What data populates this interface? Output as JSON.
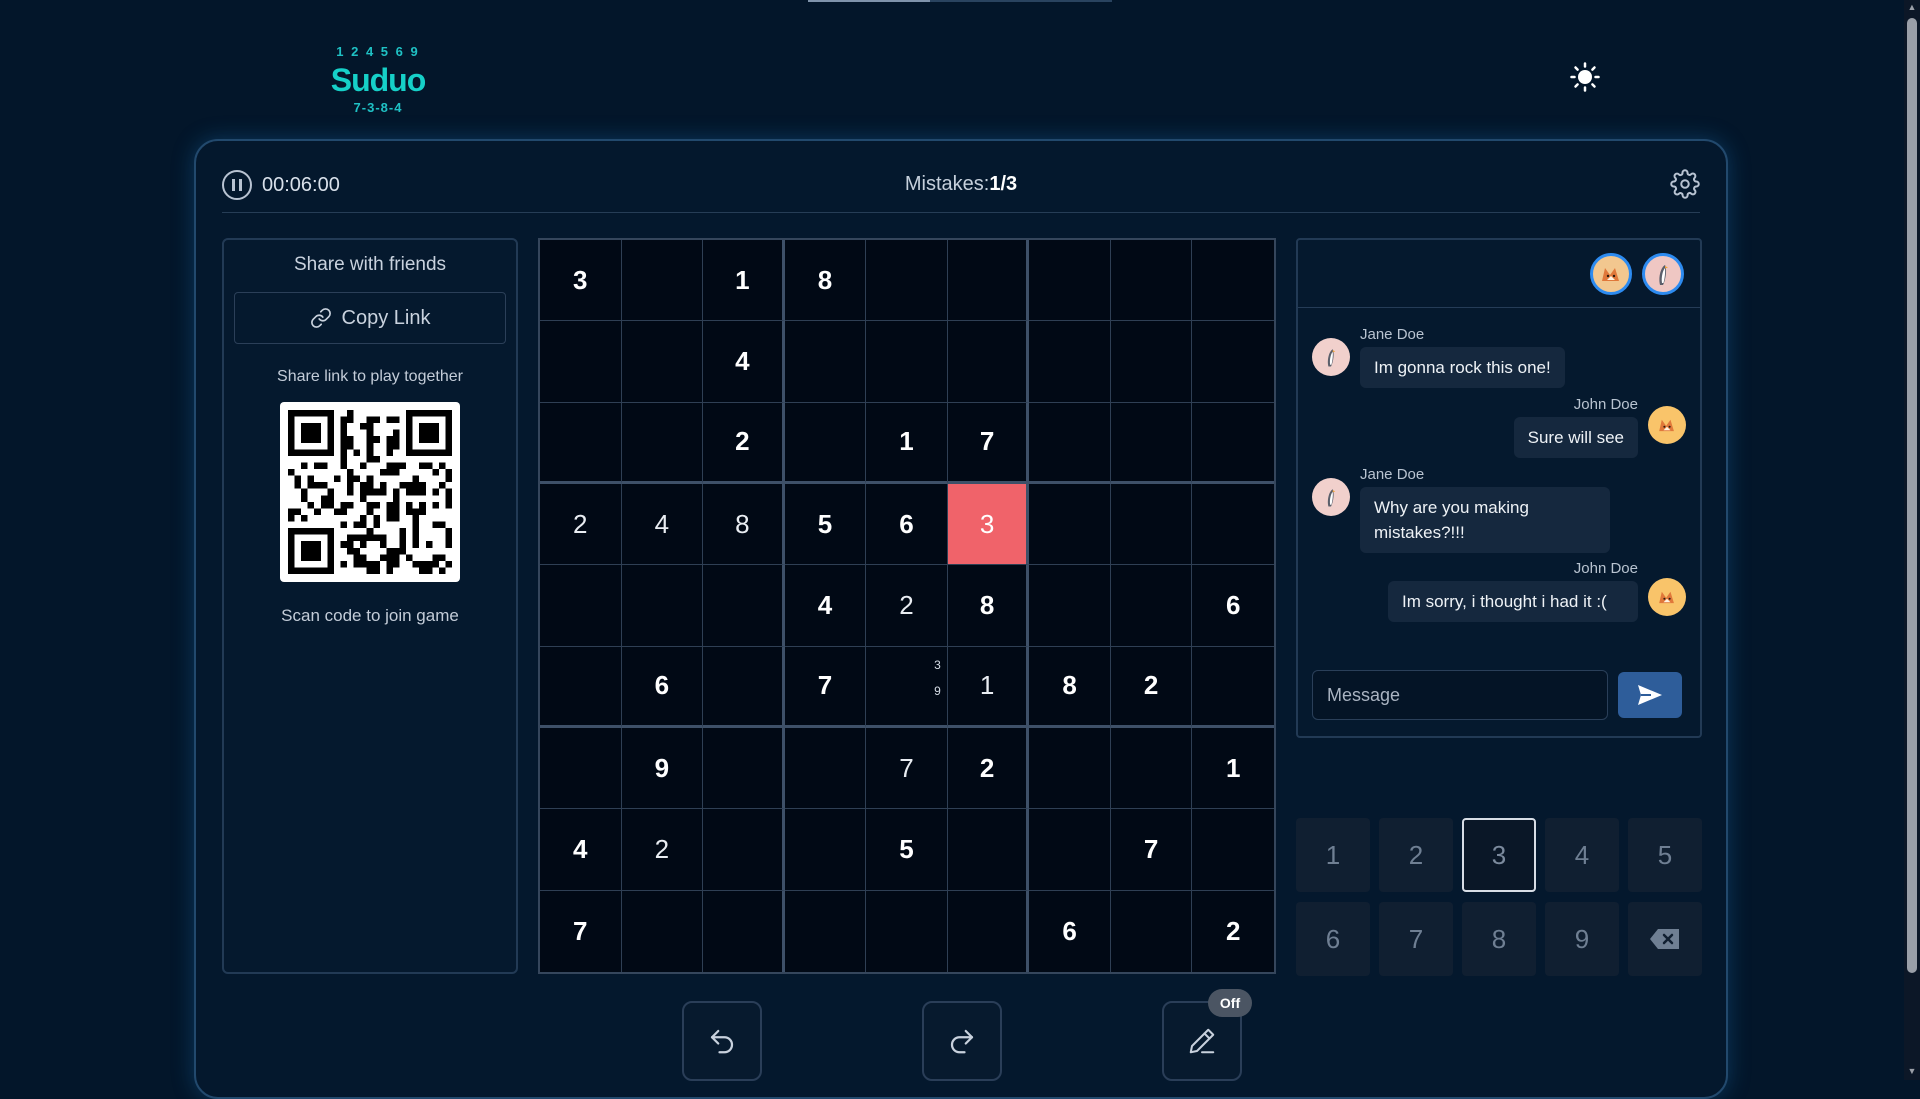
{
  "app": {
    "logo_text": "Suduo",
    "logo_numbers_top": "1 2 4 5 6 9",
    "logo_numbers_bottom": "7-3-8-4",
    "theme_icon": "sun-icon",
    "loading_progress": 0.4
  },
  "header": {
    "timer": "00:06:00",
    "mistakes_label": "Mistakes:",
    "mistakes_value": "1/3"
  },
  "share": {
    "title": "Share with friends",
    "copy_label": "Copy Link",
    "subtitle": "Share link to play together",
    "scan_label": "Scan code to join game"
  },
  "board": {
    "rows": [
      [
        {
          "v": "3",
          "t": "given"
        },
        {
          "v": "",
          "t": ""
        },
        {
          "v": "1",
          "t": "given"
        },
        {
          "v": "8",
          "t": "given"
        },
        {
          "v": "",
          "t": ""
        },
        {
          "v": "",
          "t": ""
        },
        {
          "v": "",
          "t": ""
        },
        {
          "v": "",
          "t": ""
        },
        {
          "v": "",
          "t": ""
        }
      ],
      [
        {
          "v": "",
          "t": ""
        },
        {
          "v": "",
          "t": ""
        },
        {
          "v": "4",
          "t": "given"
        },
        {
          "v": "",
          "t": ""
        },
        {
          "v": "",
          "t": ""
        },
        {
          "v": "",
          "t": ""
        },
        {
          "v": "",
          "t": ""
        },
        {
          "v": "",
          "t": ""
        },
        {
          "v": "",
          "t": ""
        }
      ],
      [
        {
          "v": "",
          "t": ""
        },
        {
          "v": "",
          "t": ""
        },
        {
          "v": "2",
          "t": "given"
        },
        {
          "v": "",
          "t": ""
        },
        {
          "v": "1",
          "t": "given"
        },
        {
          "v": "7",
          "t": "given"
        },
        {
          "v": "",
          "t": ""
        },
        {
          "v": "",
          "t": ""
        },
        {
          "v": "",
          "t": ""
        }
      ],
      [
        {
          "v": "2",
          "t": "user"
        },
        {
          "v": "4",
          "t": "user"
        },
        {
          "v": "8",
          "t": "user"
        },
        {
          "v": "5",
          "t": "given"
        },
        {
          "v": "6",
          "t": "given"
        },
        {
          "v": "3",
          "t": "error"
        },
        {
          "v": "",
          "t": ""
        },
        {
          "v": "",
          "t": ""
        },
        {
          "v": "",
          "t": ""
        }
      ],
      [
        {
          "v": "",
          "t": ""
        },
        {
          "v": "",
          "t": ""
        },
        {
          "v": "",
          "t": ""
        },
        {
          "v": "4",
          "t": "given"
        },
        {
          "v": "2",
          "t": "user"
        },
        {
          "v": "8",
          "t": "given"
        },
        {
          "v": "",
          "t": ""
        },
        {
          "v": "",
          "t": ""
        },
        {
          "v": "6",
          "t": "given"
        }
      ],
      [
        {
          "v": "",
          "t": ""
        },
        {
          "v": "6",
          "t": "given"
        },
        {
          "v": "",
          "t": ""
        },
        {
          "v": "7",
          "t": "given"
        },
        {
          "v": "",
          "t": "notes",
          "notes": [
            "3",
            "9"
          ]
        },
        {
          "v": "1",
          "t": "user"
        },
        {
          "v": "8",
          "t": "given"
        },
        {
          "v": "2",
          "t": "given"
        },
        {
          "v": "",
          "t": ""
        }
      ],
      [
        {
          "v": "",
          "t": ""
        },
        {
          "v": "9",
          "t": "given"
        },
        {
          "v": "",
          "t": ""
        },
        {
          "v": "",
          "t": ""
        },
        {
          "v": "7",
          "t": "user"
        },
        {
          "v": "2",
          "t": "given"
        },
        {
          "v": "",
          "t": ""
        },
        {
          "v": "",
          "t": ""
        },
        {
          "v": "1",
          "t": "given"
        }
      ],
      [
        {
          "v": "4",
          "t": "given"
        },
        {
          "v": "2",
          "t": "user"
        },
        {
          "v": "",
          "t": ""
        },
        {
          "v": "",
          "t": ""
        },
        {
          "v": "5",
          "t": "given"
        },
        {
          "v": "",
          "t": ""
        },
        {
          "v": "",
          "t": ""
        },
        {
          "v": "7",
          "t": "given"
        },
        {
          "v": "",
          "t": ""
        }
      ],
      [
        {
          "v": "7",
          "t": "given"
        },
        {
          "v": "",
          "t": ""
        },
        {
          "v": "",
          "t": ""
        },
        {
          "v": "",
          "t": ""
        },
        {
          "v": "",
          "t": ""
        },
        {
          "v": "",
          "t": ""
        },
        {
          "v": "6",
          "t": "given"
        },
        {
          "v": "",
          "t": ""
        },
        {
          "v": "2",
          "t": "given"
        }
      ]
    ]
  },
  "chat": {
    "participants": [
      "corgi-avatar",
      "penguin-avatar"
    ],
    "messages": [
      {
        "author": "Jane Doe",
        "text": "Im gonna rock this one!",
        "side": "left",
        "avatar": "penguin-avatar"
      },
      {
        "author": "John Doe",
        "text": "Sure will see",
        "side": "right",
        "avatar": "corgi-avatar"
      },
      {
        "author": "Jane Doe",
        "text": "Why are you making mistakes?!!!",
        "side": "left",
        "avatar": "penguin-avatar"
      },
      {
        "author": "John Doe",
        "text": "Im sorry, i thought i had it :(",
        "side": "right",
        "avatar": "corgi-avatar"
      }
    ],
    "input_placeholder": "Message",
    "input_value": ""
  },
  "numpad": {
    "keys": [
      "1",
      "2",
      "3",
      "4",
      "5",
      "6",
      "7",
      "8",
      "9"
    ],
    "selected": "3",
    "erase_icon": "backspace-icon"
  },
  "tools": {
    "undo_icon": "undo-icon",
    "redo_icon": "redo-icon",
    "notes_icon": "pencil-icon",
    "notes_state": "Off"
  },
  "colors": {
    "background": "#03162a",
    "error_cell": "#f0636a",
    "accent": "#16d0c8",
    "send_button": "#2e5d9a"
  }
}
